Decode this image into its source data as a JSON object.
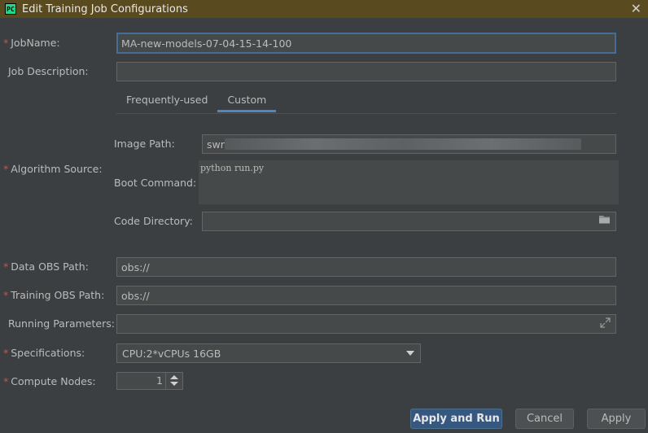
{
  "window": {
    "title": "Edit Training Job Configurations",
    "app_icon": "PC"
  },
  "form": {
    "job_name_label": "JobName:",
    "job_name_value": "MA-new-models-07-04-15-14-100",
    "job_description_label": "Job Description:",
    "job_description_value": "",
    "tabs": [
      {
        "label": "Frequently-used",
        "active": false
      },
      {
        "label": "Custom",
        "active": true
      }
    ],
    "algorithm_source_label": "Algorithm Source:",
    "image_path_label": "Image Path:",
    "image_path_value": "swr.c",
    "boot_command_label": "Boot Command:",
    "boot_command_value": "python run.py",
    "code_directory_label": "Code Directory:",
    "code_directory_value": "",
    "data_obs_path_label": "Data OBS Path:",
    "data_obs_path_value": "obs://",
    "training_obs_path_label": "Training OBS Path:",
    "training_obs_path_value": "obs://",
    "running_parameters_label": "Running Parameters:",
    "running_parameters_value": "",
    "specifications_label": "Specifications:",
    "specifications_value": "CPU:2*vCPUs 16GB",
    "compute_nodes_label": "Compute Nodes:",
    "compute_nodes_value": "1"
  },
  "buttons": {
    "apply_and_run": "Apply and Run",
    "cancel": "Cancel",
    "apply": "Apply"
  },
  "colors": {
    "background": "#3c3f41",
    "field": "#45494a",
    "accent": "#4a88c7",
    "required": "#c75450",
    "primary_button": "#365880"
  },
  "icons": [
    "close-icon",
    "folder-icon",
    "expand-icon",
    "chevron-down-icon",
    "spinner-up-icon",
    "spinner-down-icon"
  ]
}
